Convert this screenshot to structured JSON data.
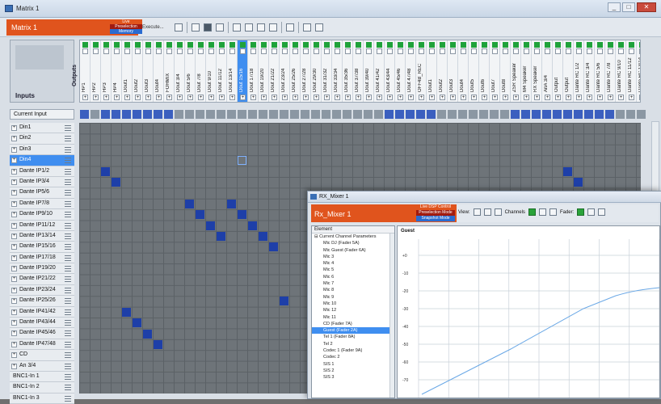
{
  "app": {
    "window_title": "Matrix 1",
    "window_buttons": [
      "_",
      "□",
      "✕"
    ]
  },
  "toolbar": {
    "name": "Matrix 1",
    "modes": [
      "Live",
      "Preselection",
      "Memory"
    ],
    "execute_label": "Execute..."
  },
  "matrix": {
    "inputs_label": "Inputs",
    "outputs_label": "Outputs",
    "current_input_label": "Current Input",
    "outputs": [
      "HP1",
      "HP2",
      "HP3",
      "HP4",
      "Dout1",
      "Dout2",
      "Dout3",
      "Dout4",
      "FOHMIX",
      "Dout 3/4",
      "Dout 5/6",
      "Dout 7/8",
      "Dout 9/10",
      "Dout 11/12",
      "Dout 13/14",
      "Dout 15/16",
      "Dout 17/18",
      "Dout 19/20",
      "Dout 21/22",
      "Dout 23/24",
      "Dout 25/26",
      "Dout 27/28",
      "Dout 29/30",
      "Dout 31/32",
      "Dout 33/34",
      "Dout 35/36",
      "Dout 37/38",
      "Dout 39/40",
      "Dout 41/42",
      "Dout 43/44",
      "Dout 45/46",
      "Dout 47/48",
      "OFF4B_REC",
      "Dout1",
      "Dout2",
      "Dout3",
      "Dout4",
      "Dout5",
      "Dout6",
      "Dout7",
      "Dout8",
      "ZSR Speaker",
      "M4 Speaker",
      "RX Speaker",
      "AnA 3/4",
      "Output",
      "Output",
      "Dante RC 1/2",
      "Dante RC 3/4",
      "Dante RC 5/6",
      "Dante RC 7/8",
      "Dante RC 9/10",
      "Dante RC 11/12",
      "Dante RC 13/14"
    ],
    "inputs": [
      "Din1",
      "Din2",
      "Din3",
      "Din4",
      "Dante IP1/2",
      "Dante IP3/4",
      "Dante IP5/6",
      "Dante IP7/8",
      "Dante IP9/10",
      "Dante IP11/12",
      "Dante IP13/14",
      "Dante IP15/16",
      "Dante IP17/18",
      "Dante IP19/20",
      "Dante IP21/22",
      "Dante IP23/24",
      "Dante IP25/26",
      "Dante IP41/42",
      "Dante IP43/44",
      "Dante IP45/46",
      "Dante IP47/48",
      "CD",
      "An 3/4",
      "BNC1-In 1",
      "BNC1-In 2",
      "BNC1-In 3"
    ],
    "selected_input_index": 3,
    "selected_output_index": 15,
    "current_input_active": [
      true,
      false,
      true,
      true,
      true,
      true,
      true,
      true,
      true,
      false,
      false,
      false,
      false,
      false,
      false,
      false,
      false,
      false,
      false,
      false,
      false,
      false,
      false,
      false,
      false,
      false,
      false,
      false,
      false,
      true,
      true,
      true,
      true,
      true,
      false,
      false,
      false,
      false,
      false,
      false,
      false,
      true,
      true,
      true,
      true,
      true,
      true,
      true,
      true,
      true,
      true,
      false,
      false,
      false
    ],
    "crosspoints": [
      [
        4,
        2
      ],
      [
        5,
        3
      ],
      [
        7,
        10
      ],
      [
        8,
        11
      ],
      [
        7,
        14
      ],
      [
        8,
        15
      ],
      [
        9,
        12
      ],
      [
        10,
        13
      ],
      [
        9,
        16
      ],
      [
        10,
        17
      ],
      [
        11,
        18
      ],
      [
        16,
        19
      ],
      [
        17,
        4
      ],
      [
        18,
        5
      ],
      [
        19,
        6
      ],
      [
        20,
        7
      ],
      [
        4,
        46
      ],
      [
        5,
        47
      ]
    ]
  },
  "mixer": {
    "title": "RX_Mixer 1",
    "name": "Rx_Mixer 1",
    "modes": [
      "Live DSP Control",
      "Preselection Mode",
      "Snapshot Mode"
    ],
    "view_label": "View:",
    "channels_label": "Channels",
    "fader_label": "Fader:",
    "list_header": "Element",
    "list_items": [
      {
        "t": "Current Channel Parameters",
        "ind": false
      },
      {
        "t": "Mic    DJ (Fader 5A)",
        "ind": true
      },
      {
        "t": "Mic    Guest (Fader 6A)",
        "ind": true
      },
      {
        "t": "Mic 3",
        "ind": true
      },
      {
        "t": "Mic 4",
        "ind": true
      },
      {
        "t": "Mic 5",
        "ind": true
      },
      {
        "t": "Mic 6",
        "ind": true
      },
      {
        "t": "Mic 7",
        "ind": true
      },
      {
        "t": "Mic 8",
        "ind": true
      },
      {
        "t": "Mic 9",
        "ind": true
      },
      {
        "t": "Mic 10",
        "ind": true
      },
      {
        "t": "Mic 12",
        "ind": true
      },
      {
        "t": "Mic 11",
        "ind": true
      },
      {
        "t": "CD (Fader 7A)",
        "ind": true
      },
      {
        "t": "Guest (Fader 2A)",
        "ind": true
      },
      {
        "t": "Tel 1 (Fader 8A)",
        "ind": true
      },
      {
        "t": "Tel 2",
        "ind": true
      },
      {
        "t": "Codec 1 (Fader 9A)",
        "ind": true
      },
      {
        "t": "Codec 2",
        "ind": true
      },
      {
        "t": "SIS 1",
        "ind": true
      },
      {
        "t": "SIS 2",
        "ind": true
      },
      {
        "t": "SIS 3",
        "ind": true
      }
    ],
    "selected_item_index": 14,
    "graph_title": "Guest",
    "y_ticks": [
      "+0",
      "-10",
      "-20",
      "-30",
      "-40",
      "-50",
      "-60",
      "-70"
    ],
    "accent": "#e0541d",
    "curve_color": "#6aa8e6"
  }
}
